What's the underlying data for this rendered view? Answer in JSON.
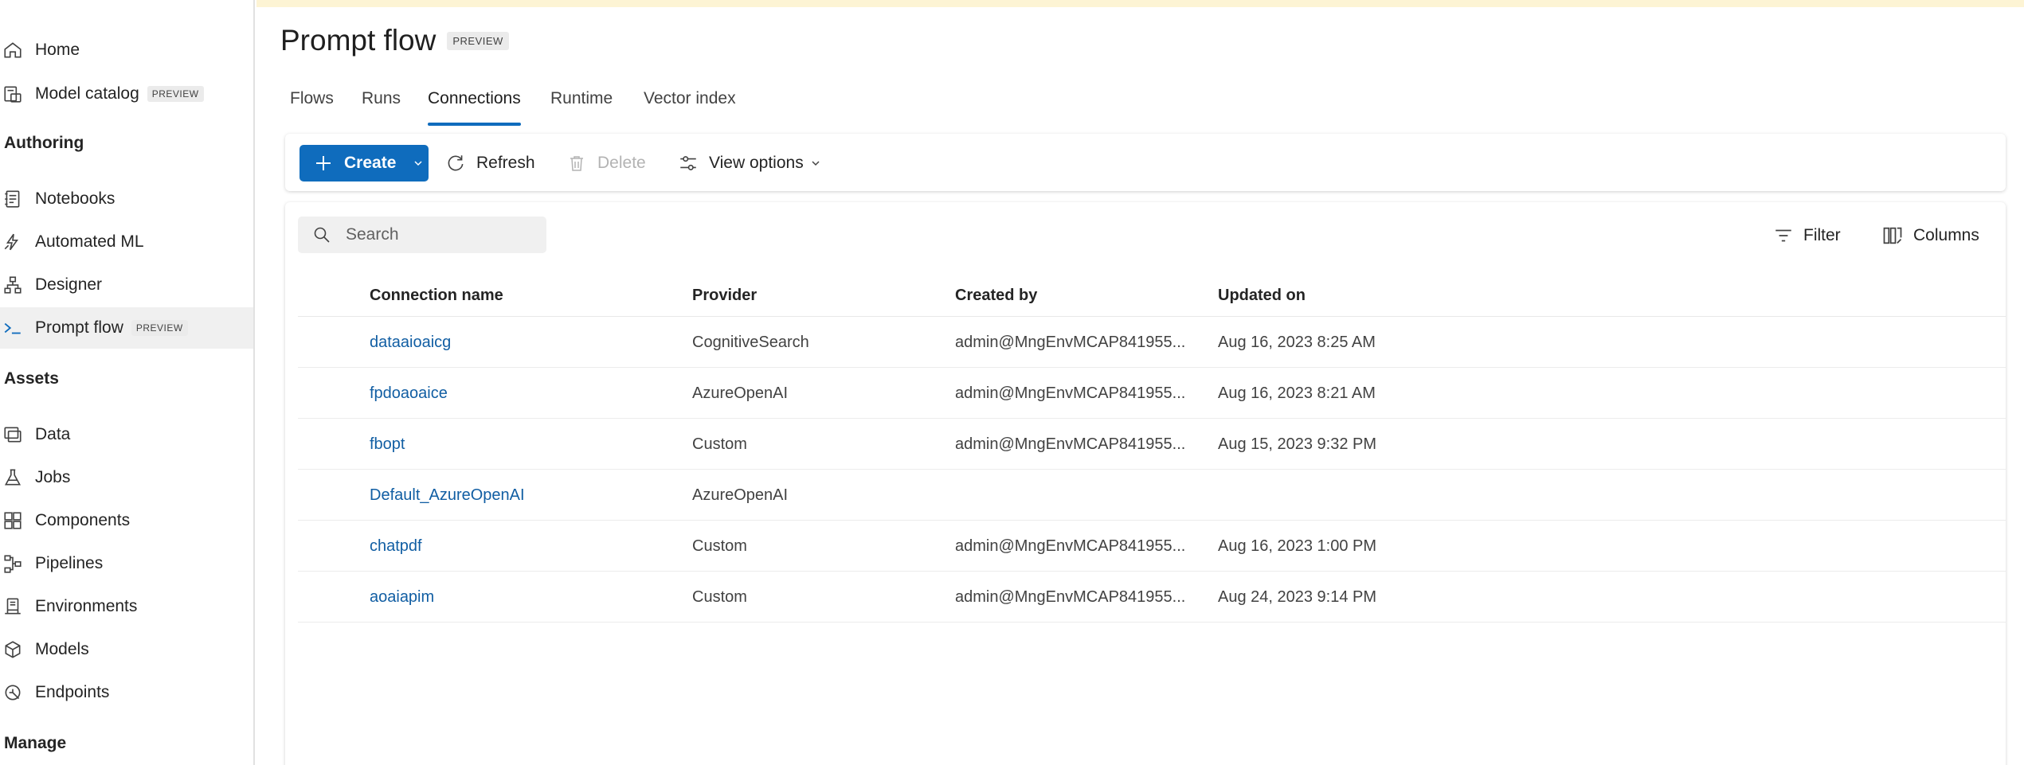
{
  "sidebar": {
    "items_top": [
      {
        "label": "Home",
        "icon": "home-icon"
      },
      {
        "label": "Model catalog",
        "icon": "catalog-icon",
        "badge": "PREVIEW"
      }
    ],
    "sections": [
      {
        "heading": "Authoring",
        "items": [
          {
            "label": "Notebooks",
            "icon": "notebook-icon"
          },
          {
            "label": "Automated ML",
            "icon": "automl-icon"
          },
          {
            "label": "Designer",
            "icon": "designer-icon"
          },
          {
            "label": "Prompt flow",
            "icon": "prompt-flow-icon",
            "badge": "PREVIEW",
            "active": true
          }
        ]
      },
      {
        "heading": "Assets",
        "items": [
          {
            "label": "Data",
            "icon": "data-icon"
          },
          {
            "label": "Jobs",
            "icon": "jobs-icon"
          },
          {
            "label": "Components",
            "icon": "components-icon"
          },
          {
            "label": "Pipelines",
            "icon": "pipelines-icon"
          },
          {
            "label": "Environments",
            "icon": "environments-icon"
          },
          {
            "label": "Models",
            "icon": "models-icon"
          },
          {
            "label": "Endpoints",
            "icon": "endpoints-icon"
          }
        ]
      },
      {
        "heading": "Manage",
        "items": []
      }
    ]
  },
  "page": {
    "title": "Prompt flow",
    "badge": "PREVIEW"
  },
  "tabs": [
    {
      "label": "Flows"
    },
    {
      "label": "Runs"
    },
    {
      "label": "Connections",
      "active": true
    },
    {
      "label": "Runtime"
    },
    {
      "label": "Vector index"
    }
  ],
  "toolbar": {
    "create_label": "Create",
    "refresh_label": "Refresh",
    "delete_label": "Delete",
    "view_options_label": "View options"
  },
  "grid": {
    "search_placeholder": "Search",
    "filter_label": "Filter",
    "columns_label": "Columns",
    "headers": [
      "Connection name",
      "Provider",
      "Created by",
      "Updated on"
    ],
    "rows": [
      {
        "name": "dataaioaicg",
        "provider": "CognitiveSearch",
        "created_by": "admin@MngEnvMCAP841955....",
        "updated_on": "Aug 16, 2023 8:25 AM"
      },
      {
        "name": "fpdoaoaice",
        "provider": "AzureOpenAI",
        "created_by": "admin@MngEnvMCAP841955....",
        "updated_on": "Aug 16, 2023 8:21 AM"
      },
      {
        "name": "fbopt",
        "provider": "Custom",
        "created_by": "admin@MngEnvMCAP841955....",
        "updated_on": "Aug 15, 2023 9:32 PM"
      },
      {
        "name": "Default_AzureOpenAI",
        "provider": "AzureOpenAI",
        "created_by": "",
        "updated_on": ""
      },
      {
        "name": "chatpdf",
        "provider": "Custom",
        "created_by": "admin@MngEnvMCAP841955....",
        "updated_on": "Aug 16, 2023 1:00 PM"
      },
      {
        "name": "aoaiapim",
        "provider": "Custom",
        "created_by": "admin@MngEnvMCAP841955....",
        "updated_on": "Aug 24, 2023 9:14 PM"
      }
    ]
  },
  "colors": {
    "accent": "#0f6cbd",
    "link": "#115ea3",
    "banner": "#fdf4d4",
    "active_nav": "#f0f0f0"
  }
}
